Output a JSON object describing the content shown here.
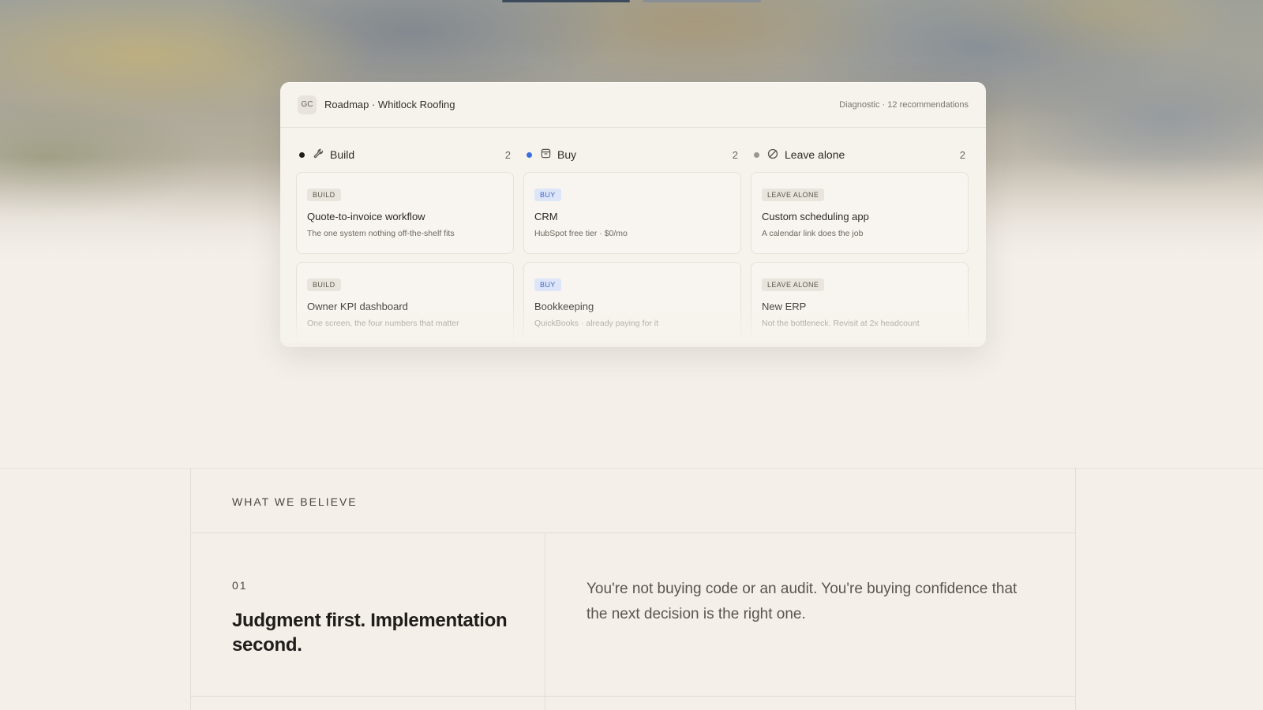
{
  "roadmap": {
    "badge": "GC",
    "title": "Roadmap · Whitlock Roofing",
    "meta": "Diagnostic · 12 recommendations",
    "columns": [
      {
        "label": "Build",
        "count": "2",
        "dot_color": "#1f1c19",
        "icon": "wrench-icon",
        "cards": [
          {
            "tag": "BUILD",
            "title": "Quote-to-invoice workflow",
            "sub": "The one system nothing off-the-shelf fits"
          },
          {
            "tag": "BUILD",
            "title": "Owner KPI dashboard",
            "sub": "One screen, the four numbers that matter"
          }
        ]
      },
      {
        "label": "Buy",
        "count": "2",
        "dot_color": "#3b6fe0",
        "icon": "box-icon",
        "cards": [
          {
            "tag": "BUY",
            "title": "CRM",
            "sub": "HubSpot free tier · $0/mo"
          },
          {
            "tag": "BUY",
            "title": "Bookkeeping",
            "sub": "QuickBooks · already paying for it"
          }
        ]
      },
      {
        "label": "Leave alone",
        "count": "2",
        "dot_color": "#9c968d",
        "icon": "slashed-circle-icon",
        "cards": [
          {
            "tag": "LEAVE ALONE",
            "title": "Custom scheduling app",
            "sub": "A calendar link does the job"
          },
          {
            "tag": "LEAVE ALONE",
            "title": "New ERP",
            "sub": "Not the bottleneck. Revisit at 2x headcount"
          }
        ]
      }
    ]
  },
  "beliefs": {
    "section_label": "WHAT WE BELIEVE",
    "items": [
      {
        "number": "01",
        "title": "Judgment first. Implementation second.",
        "body": "You're not buying code or an audit. You're buying confidence that the next decision is the right one."
      }
    ]
  }
}
